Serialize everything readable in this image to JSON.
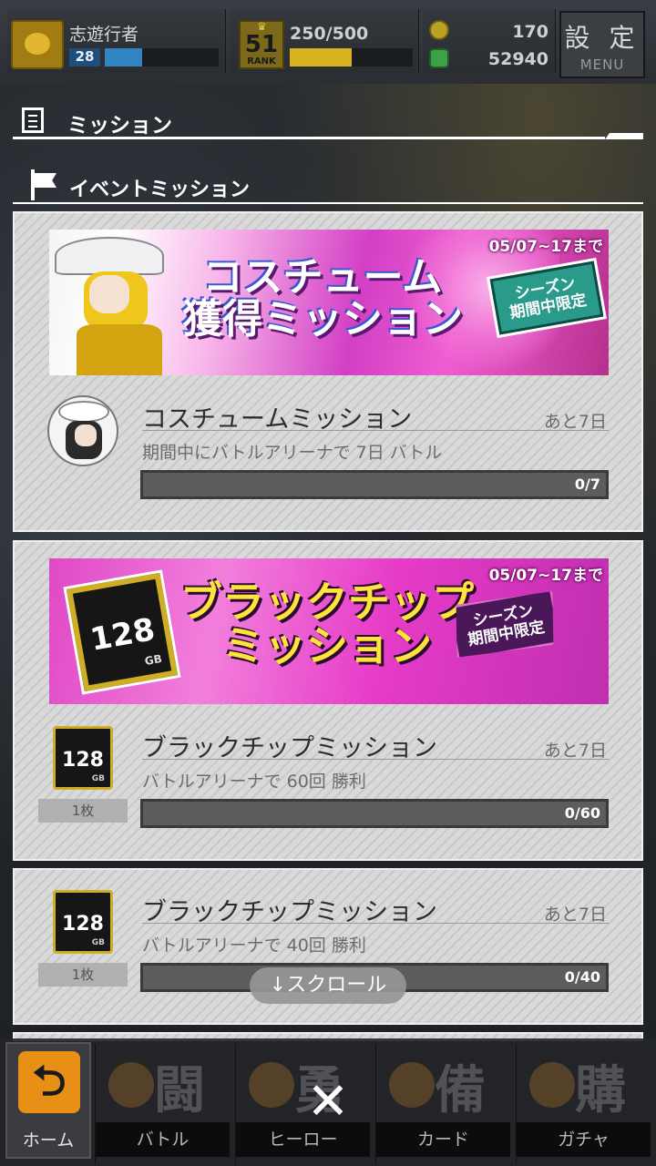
{
  "header": {
    "player_name": "志遊行者",
    "player_level": "28",
    "level_progress": 0.33,
    "rank": "51",
    "rank_label": "RANK",
    "stamina_text": "250/500",
    "stamina_progress": 0.5,
    "currency1": "170",
    "currency2": "52940",
    "settings_kanji": "設 定",
    "settings_label": "MENU"
  },
  "section_title": "ミッション",
  "subsection_title": "イベントミッション",
  "cards": [
    {
      "banner_date": "05/07~17まで",
      "banner_title_line1": "コスチューム",
      "banner_title_line2": "獲得ミッション",
      "banner_badge_line1": "シーズン",
      "banner_badge_line2": "期間中限定",
      "mission_title": "コスチュームミッション",
      "remaining": "あと7日",
      "description": "期間中にバトルアリーナで 7日 バトル",
      "progress_text": "0/7",
      "progress": 0
    },
    {
      "banner_date": "05/07~17まで",
      "banner_title_line1": "ブラックチップ",
      "banner_title_line2": "ミッション",
      "banner_badge_line1": "シーズン",
      "banner_badge_line2": "期間中限定",
      "chip_number": "128",
      "chip_unit": "GB",
      "mission_title": "ブラックチップミッション",
      "remaining": "あと7日",
      "description": "バトルアリーナで 60回 勝利",
      "reward_qty": "1枚",
      "progress_text": "0/60",
      "progress": 0
    },
    {
      "chip_number": "128",
      "chip_unit": "GB",
      "mission_title": "ブラックチップミッション",
      "remaining": "あと7日",
      "description": "バトルアリーナで 40回 勝利",
      "reward_qty": "1枚",
      "progress_text": "0/40",
      "progress": 0
    }
  ],
  "scroll_hint": "↓スクロール",
  "nav": {
    "home": "ホーム",
    "battle_kanji": "闘",
    "battle": "バトル",
    "hero_kanji": "勇",
    "hero": "ヒーロー",
    "card_kanji": "備",
    "card": "カード",
    "gacha_kanji": "購",
    "gacha": "ガチャ",
    "close": "✕"
  },
  "colors": {
    "accent_yellow": "#d7b21d",
    "level_blue": "#2f86c2",
    "home_orange": "#e89016",
    "banner_pink": "#e049c6"
  }
}
